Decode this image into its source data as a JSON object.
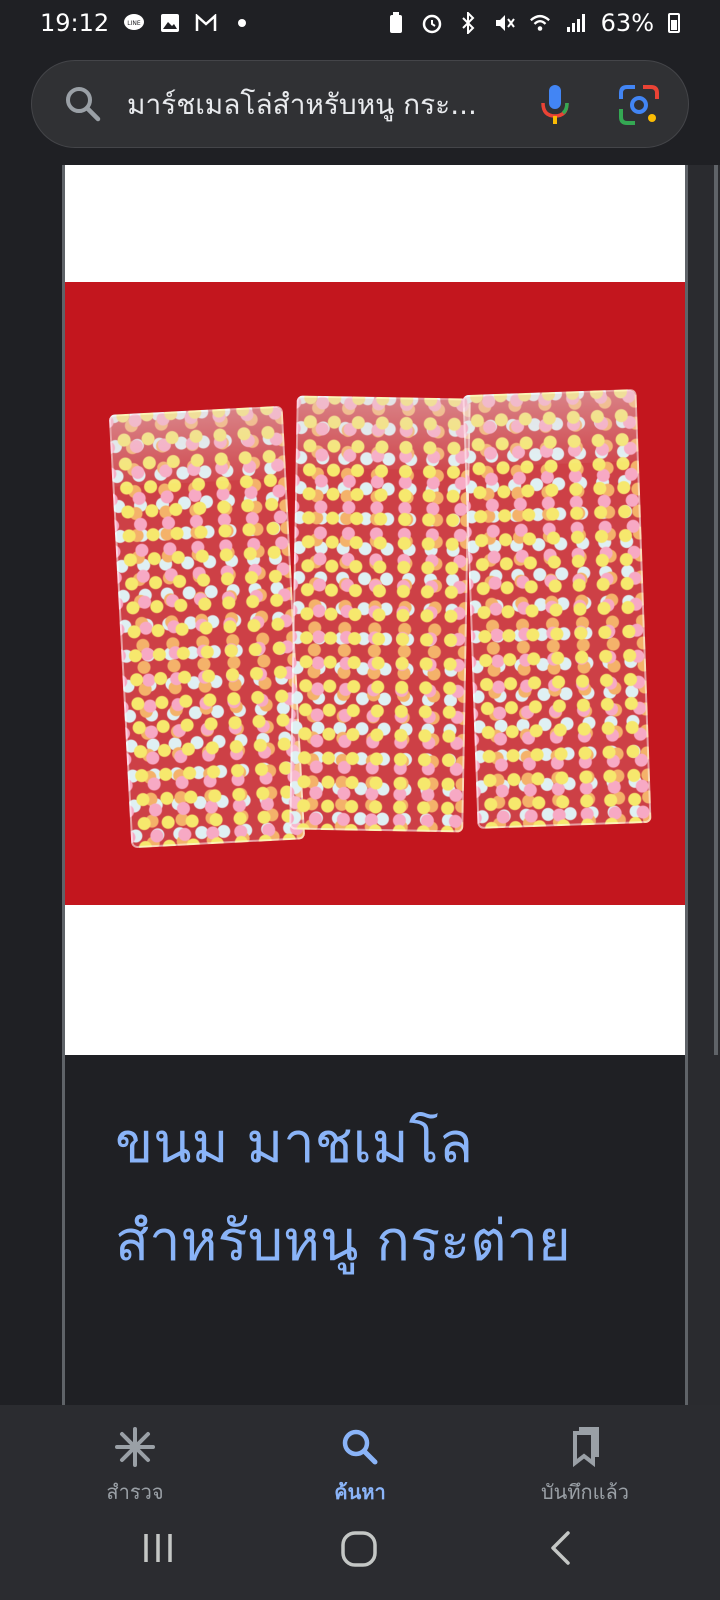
{
  "status_bar": {
    "time": "19:12",
    "battery": "63%",
    "left_icons": [
      "line-icon",
      "gallery-icon",
      "gmail-icon",
      "dot-icon"
    ],
    "right_icons": [
      "battery-saver-icon",
      "alarm-icon",
      "bluetooth-icon",
      "mute-icon",
      "wifi-icon",
      "signal-icon"
    ]
  },
  "search": {
    "query": "มาร์ชเมลโล่สำหรับหนู กระ..."
  },
  "result": {
    "caption": "ขนม มาชเมโล สำหรับหนู กระต่าย",
    "image_alt": "marshmallow-bags-photo"
  },
  "bottom_nav": {
    "items": [
      {
        "label": "สำรวจ",
        "icon": "asterisk-icon"
      },
      {
        "label": "ค้นหา",
        "icon": "search-icon"
      },
      {
        "label": "บันทึกแล้ว",
        "icon": "bookmark-icon"
      }
    ],
    "active": "ค้นหา"
  },
  "colors": {
    "accent": "#8ab4f8",
    "background": "#1f2024",
    "photo_background": "#c3161e"
  }
}
